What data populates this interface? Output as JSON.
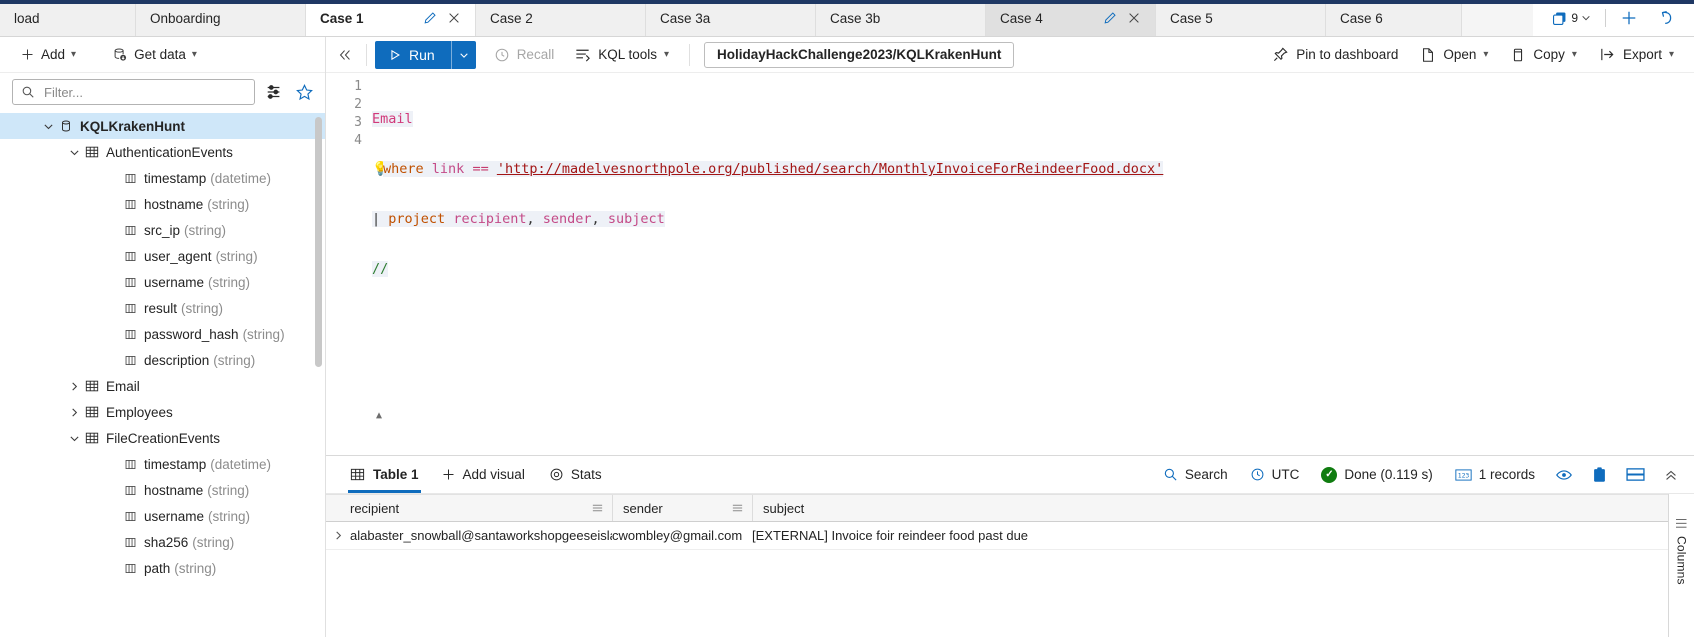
{
  "tabs": [
    {
      "label": "load",
      "state": "normal",
      "has_actions": false
    },
    {
      "label": "Onboarding",
      "state": "normal",
      "has_actions": false
    },
    {
      "label": "Case 1",
      "state": "active",
      "has_actions": true
    },
    {
      "label": "Case 2",
      "state": "normal",
      "has_actions": false
    },
    {
      "label": "Case 3a",
      "state": "normal",
      "has_actions": false
    },
    {
      "label": "Case 3b",
      "state": "normal",
      "has_actions": false
    },
    {
      "label": "Case 4",
      "state": "current",
      "has_actions": true
    },
    {
      "label": "Case 5",
      "state": "normal",
      "has_actions": false
    },
    {
      "label": "Case 6",
      "state": "normal",
      "has_actions": false
    }
  ],
  "tabstrip_right": {
    "tab_count": "9",
    "tab_count_icon": "copy-stack-icon",
    "new_tab_icon": "plus-icon",
    "restore_icon": "undo-arrow-icon"
  },
  "left_panel": {
    "toolbar": {
      "add_label": "Add",
      "add_icon": "plus-icon",
      "get_data_label": "Get data",
      "get_data_icon": "database-download-icon"
    },
    "filter": {
      "placeholder": "Filter...",
      "value": "",
      "icon": "search-icon"
    },
    "filter_actions": [
      {
        "name": "filter-settings-icon"
      },
      {
        "name": "favorite-star-icon"
      }
    ],
    "tree": [
      {
        "label": "KQLKrakenHunt",
        "type": "",
        "icon": "database-icon",
        "indent": 0,
        "chevron": "down",
        "selected": true
      },
      {
        "label": "AuthenticationEvents",
        "type": "",
        "icon": "table-icon",
        "indent": 1,
        "chevron": "down",
        "selected": false
      },
      {
        "label": "timestamp",
        "type": "(datetime)",
        "icon": "column-icon",
        "indent": 2,
        "chevron": "",
        "selected": false
      },
      {
        "label": "hostname",
        "type": "(string)",
        "icon": "column-icon",
        "indent": 2,
        "chevron": "",
        "selected": false
      },
      {
        "label": "src_ip",
        "type": "(string)",
        "icon": "column-icon",
        "indent": 2,
        "chevron": "",
        "selected": false
      },
      {
        "label": "user_agent",
        "type": "(string)",
        "icon": "column-icon",
        "indent": 2,
        "chevron": "",
        "selected": false
      },
      {
        "label": "username",
        "type": "(string)",
        "icon": "column-icon",
        "indent": 2,
        "chevron": "",
        "selected": false
      },
      {
        "label": "result",
        "type": "(string)",
        "icon": "column-icon",
        "indent": 2,
        "chevron": "",
        "selected": false
      },
      {
        "label": "password_hash",
        "type": "(string)",
        "icon": "column-icon",
        "indent": 2,
        "chevron": "",
        "selected": false
      },
      {
        "label": "description",
        "type": "(string)",
        "icon": "column-icon",
        "indent": 2,
        "chevron": "",
        "selected": false
      },
      {
        "label": "Email",
        "type": "",
        "icon": "table-icon",
        "indent": 1,
        "chevron": "right",
        "selected": false
      },
      {
        "label": "Employees",
        "type": "",
        "icon": "table-icon",
        "indent": 1,
        "chevron": "right",
        "selected": false
      },
      {
        "label": "FileCreationEvents",
        "type": "",
        "icon": "table-icon",
        "indent": 1,
        "chevron": "down",
        "selected": false
      },
      {
        "label": "timestamp",
        "type": "(datetime)",
        "icon": "column-icon",
        "indent": 2,
        "chevron": "",
        "selected": false
      },
      {
        "label": "hostname",
        "type": "(string)",
        "icon": "column-icon",
        "indent": 2,
        "chevron": "",
        "selected": false
      },
      {
        "label": "username",
        "type": "(string)",
        "icon": "column-icon",
        "indent": 2,
        "chevron": "",
        "selected": false
      },
      {
        "label": "sha256",
        "type": "(string)",
        "icon": "column-icon",
        "indent": 2,
        "chevron": "",
        "selected": false
      },
      {
        "label": "path",
        "type": "(string)",
        "icon": "column-icon",
        "indent": 2,
        "chevron": "",
        "selected": false
      }
    ]
  },
  "query_toolbar": {
    "collapse_icon": "chevron-double-left-icon",
    "run_label": "Run",
    "run_icon": "play-icon",
    "run_caret_icon": "chevron-down-icon",
    "recall_label": "Recall",
    "recall_icon": "recall-clock-icon",
    "recall_disabled": true,
    "kql_tools_label": "KQL tools",
    "kql_tools_icon": "kql-tools-icon",
    "database_path": "HolidayHackChallenge2023/KQLKrakenHunt",
    "right_actions": [
      {
        "label": "Pin to dashboard",
        "icon": "pin-icon",
        "caret": false
      },
      {
        "label": "Open",
        "icon": "document-icon",
        "caret": true
      },
      {
        "label": "Copy",
        "icon": "copy-icon",
        "caret": true
      },
      {
        "label": "Export",
        "icon": "export-icon",
        "caret": true
      }
    ]
  },
  "editor": {
    "line_numbers": [
      "1",
      "2",
      "3",
      "4"
    ],
    "lines": [
      {
        "n": 1,
        "text": "Email"
      },
      {
        "n": 2,
        "text": "| where link == 'http://madelvesnorthpole.org/published/search/MonthlyInvoiceForReindeerFood.docx'"
      },
      {
        "n": 3,
        "text": "| project recipient, sender, subject"
      },
      {
        "n": 4,
        "text": "//"
      }
    ],
    "tokens": {
      "table": "Email",
      "pipe": "|",
      "where": "where",
      "link": "link",
      "eq": "==",
      "url_literal": "'http://madelvesnorthpole.org/published/search/MonthlyInvoiceForReindeerFood.docx'",
      "project": "project",
      "col1": "recipient",
      "col2": "sender",
      "col3": "subject",
      "comment": "//"
    },
    "lightbulb_icon": "lightbulb-icon"
  },
  "results": {
    "tab_label": "Table 1",
    "tab_icon": "table-icon",
    "add_visual_label": "Add visual",
    "add_visual_icon": "plus-icon",
    "stats_label": "Stats",
    "stats_icon": "stats-target-icon",
    "search_label": "Search",
    "search_icon": "search-icon",
    "timezone_label": "UTC",
    "timezone_icon": "clock-icon",
    "status_label": "Done (0.119 s)",
    "status_icon": "check-circle-icon",
    "status_color": "#107c10",
    "records_label": "1 records",
    "records_icon": "numbers-icon",
    "right_icons": [
      {
        "name": "eye-icon"
      },
      {
        "name": "clipboard-icon"
      },
      {
        "name": "layout-rows-icon"
      },
      {
        "name": "chevron-double-up-icon"
      }
    ],
    "columns_rail_label": "Columns",
    "columns_rail_grip_icon": "grip-icon",
    "grid": {
      "headers": [
        "recipient",
        "sender",
        "subject"
      ],
      "header_menu_icon": "column-menu-icon",
      "row_expander_icon": "chevron-right-icon",
      "rows": [
        {
          "recipient": "alabaster_snowball@santaworkshopgeeseislands.org",
          "sender": "cwombley@gmail.com",
          "subject": "[EXTERNAL] Invoice foir reindeer food past due"
        }
      ]
    }
  },
  "colors": {
    "accent": "#0f6cbd",
    "title_bar": "#1f3864",
    "selection": "#cfe7f9",
    "success": "#107c10"
  }
}
